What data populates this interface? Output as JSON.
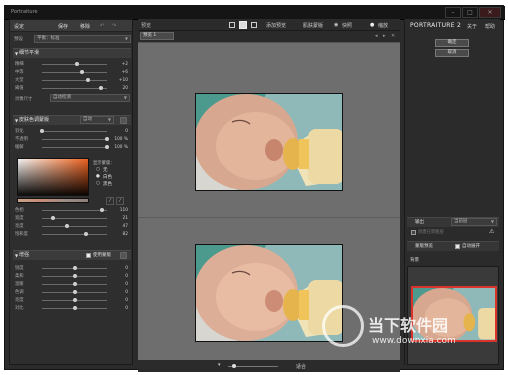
{
  "app": {
    "title": "Portraiture"
  },
  "toolbar": {
    "settings_label": "设定",
    "save_label": "保存",
    "delete_label": "移除",
    "preview_label": "预览",
    "add_preview_label": "添加预览",
    "show_mask_label": "肌肤蒙版",
    "quick_label": "快照",
    "zoom_label": "缩放"
  },
  "left": {
    "preset_label": "预设",
    "preset_value": "平衡：标准",
    "detail_section": "细节平滑",
    "detail_sliders": [
      {
        "label": "精细",
        "value": "+2"
      },
      {
        "label": "中等",
        "value": "+6"
      },
      {
        "label": "大型",
        "value": "+10"
      },
      {
        "label": "阈值",
        "value": "20"
      }
    ],
    "portrait_size_label": "肖像尺寸",
    "portrait_size_value": "自动检测",
    "skin_section": "皮肤色调蒙版",
    "skin_mode": "自动",
    "skin_sliders1": [
      {
        "label": "羽化",
        "value": "0"
      },
      {
        "label": "不透明",
        "value": "100 %"
      },
      {
        "label": "缓解",
        "value": "100 %"
      }
    ],
    "show_mask_title": "显示蒙版：",
    "mask_options": [
      "无",
      "白色",
      "黑色"
    ],
    "skin_sliders2": [
      {
        "label": "色相",
        "value": "110"
      },
      {
        "label": "宽度",
        "value": "21"
      },
      {
        "label": "亮度",
        "value": "47"
      },
      {
        "label": "饱和度",
        "value": "82"
      }
    ],
    "enhance_section": "增强",
    "enhance_check": "使用蒙版",
    "enhance_sliders": [
      {
        "label": "锐度",
        "value": "0"
      },
      {
        "label": "柔和",
        "value": "0"
      },
      {
        "label": "温暖",
        "value": "0"
      },
      {
        "label": "色调",
        "value": "0"
      },
      {
        "label": "亮度",
        "value": "0"
      },
      {
        "label": "对比",
        "value": "0"
      }
    ]
  },
  "center": {
    "tab_label": "预览 1",
    "zoom_value": "适合"
  },
  "right": {
    "logo": "PORTRAITURE 2",
    "about_label": "关于",
    "help_label": "帮助",
    "ok_label": "确定",
    "cancel_label": "取消",
    "output_label": "输出",
    "output_value": "当前层",
    "new_layer_label": "创建在新图层",
    "mask_preview_label": "蒙版预览",
    "auto_open_label": "自动展开",
    "bg_label": "背景"
  },
  "watermark": {
    "line1": "当下软件园",
    "line2": "www.downxia.com"
  },
  "colors": {
    "accent": "#d9342b",
    "panel": "#2e2e2e",
    "viewer": "#6e6e6e"
  }
}
